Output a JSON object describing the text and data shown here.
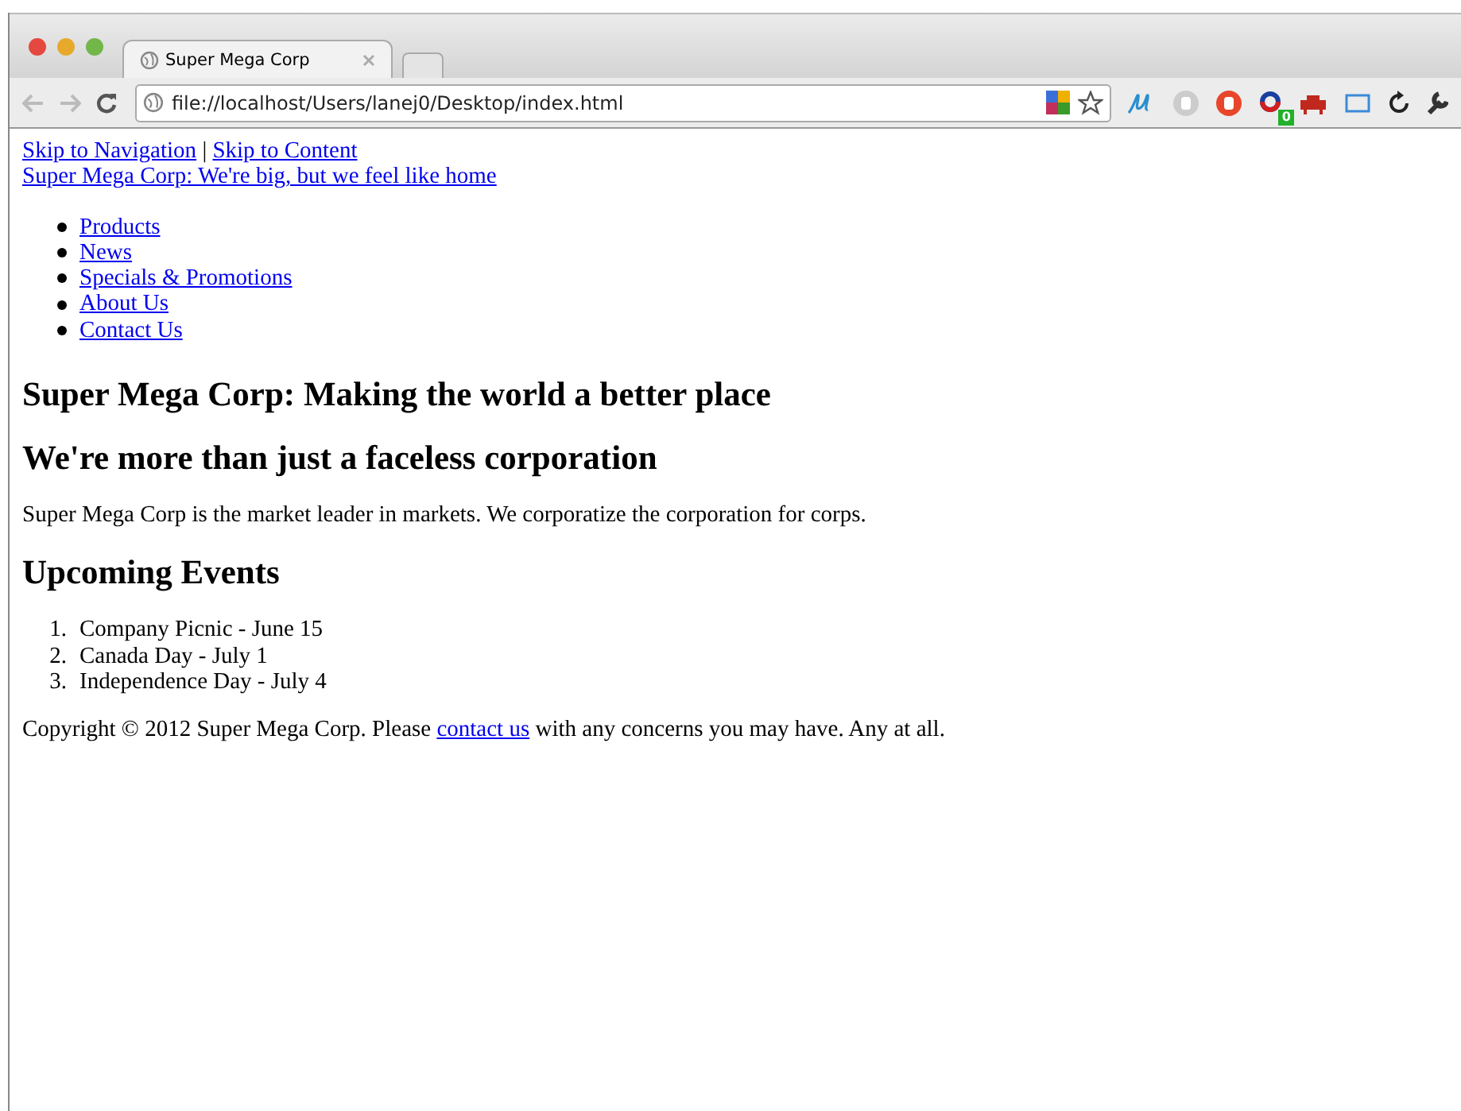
{
  "browser": {
    "tab": {
      "title": "Super Mega Corp",
      "selected": true
    },
    "address": "file://localhost/Users/lanej0/Desktop/index.html",
    "extension_badge": "0"
  },
  "page": {
    "skip_links": [
      "Skip to Navigation",
      "Skip to Content"
    ],
    "separator": "|",
    "site_link": "Super Mega Corp: We're big, but we feel like home",
    "nav": [
      "Products",
      "News",
      "Specials & Promotions",
      "About Us",
      "Contact Us"
    ],
    "heading_1": "Super Mega Corp: Making the world a better place",
    "heading_2": "We're more than just a faceless corporation",
    "intro": "Super Mega Corp is the market leader in markets. We corporatize the corporation for corps.",
    "events_heading": "Upcoming Events",
    "events": [
      {
        "number": "1.",
        "text": "Company Picnic - June 15"
      },
      {
        "number": "2.",
        "text": "Canada Day - July 1"
      },
      {
        "number": "3.",
        "text": "Independence Day - July 4"
      }
    ],
    "footer": {
      "before": "Copyright © 2012 Super Mega Corp. Please",
      "link": "contact us",
      "after": "with any concerns you may have. Any at all."
    }
  }
}
